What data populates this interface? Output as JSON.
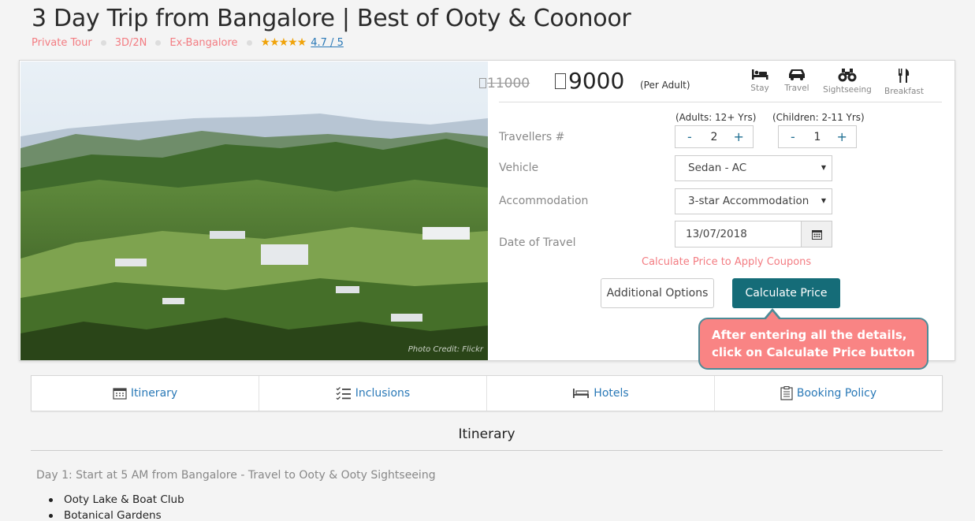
{
  "header": {
    "title": "3 Day Trip from Bangalore | Best of Ooty & Coonoor",
    "tags": [
      "Private Tour",
      "3D/2N",
      "Ex-Bangalore"
    ],
    "stars": "★★★★★",
    "rating": "4.7 / 5"
  },
  "photo": {
    "credit": "Photo Credit: Flickr"
  },
  "pricing": {
    "old_price": "11000",
    "new_price": "9000",
    "per_label": "(Per Adult)"
  },
  "features": [
    {
      "label": "Stay",
      "icon": "bed-icon"
    },
    {
      "label": "Travel",
      "icon": "car-icon"
    },
    {
      "label": "Sightseeing",
      "icon": "binoculars-icon"
    },
    {
      "label": "Breakfast",
      "icon": "cutlery-icon"
    }
  ],
  "form": {
    "travellers_label": "Travellers #",
    "adults_label": "(Adults: 12+ Yrs)",
    "children_label": "(Children: 2-11 Yrs)",
    "adults_value": "2",
    "children_value": "1",
    "minus": "-",
    "plus": "+",
    "vehicle_label": "Vehicle",
    "vehicle_value": "Sedan - AC",
    "accommodation_label": "Accommodation",
    "accommodation_value": "3-star Accommodation",
    "date_label": "Date of Travel",
    "date_value": "13/07/2018",
    "coupon_note": "Calculate Price to Apply Coupons",
    "additional_options": "Additional Options",
    "calculate_price": "Calculate Price"
  },
  "tooltip": {
    "line1": "After entering all the details,",
    "line2": "click on Calculate Price button"
  },
  "tabs": [
    "Itinerary",
    "Inclusions",
    "Hotels",
    "Booking Policy"
  ],
  "itinerary": {
    "section_title": "Itinerary",
    "day1_title": "Day 1: Start at 5 AM from Bangalore - Travel to Ooty & Ooty Sightseeing",
    "day1_items": [
      "Ooty Lake & Boat Club",
      "Botanical Gardens"
    ]
  },
  "colors": {
    "accent_pink": "#f37c82",
    "primary_button": "#156c78",
    "link_blue": "#2a79b7",
    "star_gold": "#f0a30a",
    "tooltip_bg": "#f98484"
  }
}
